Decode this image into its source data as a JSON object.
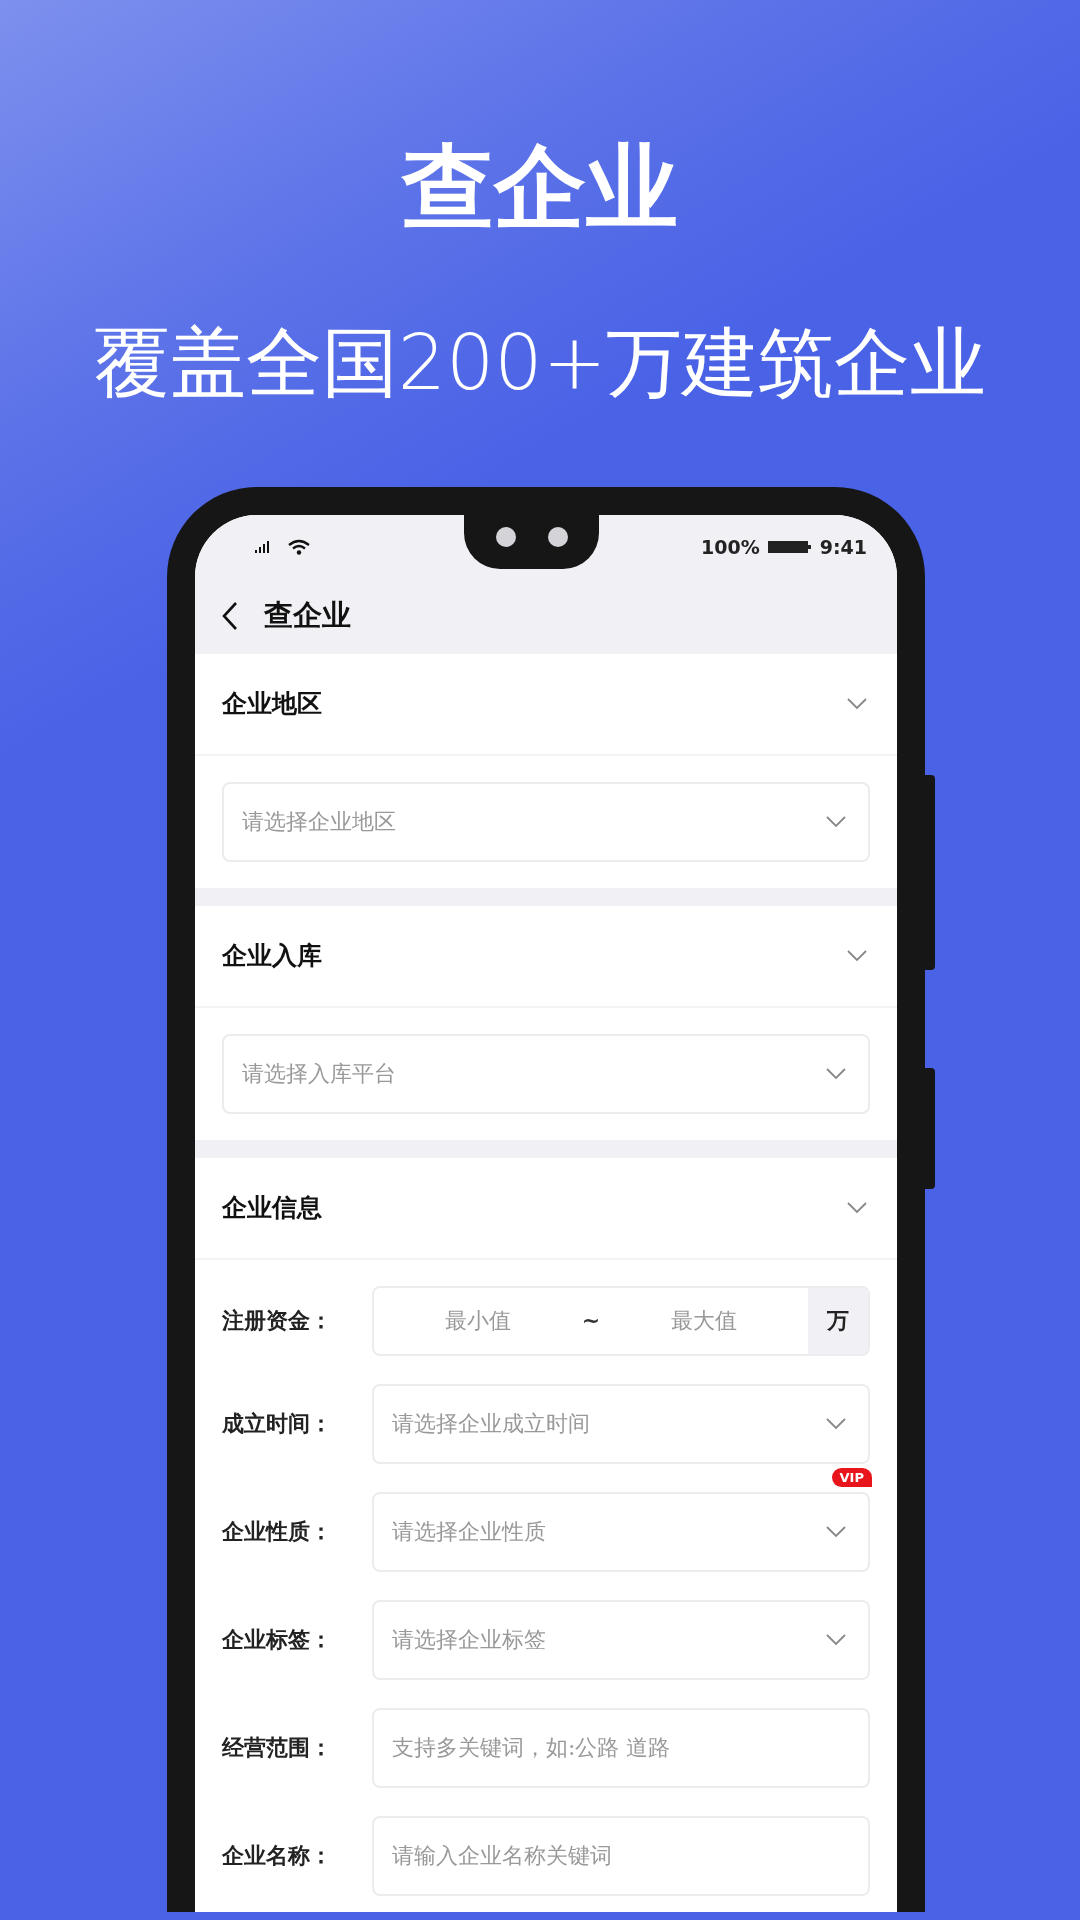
{
  "headline": "查企业",
  "subheadline": "覆盖全国200+万建筑企业",
  "status_bar": {
    "battery": "100%",
    "time": "9:41"
  },
  "nav": {
    "title": "查企业"
  },
  "sections": [
    {
      "title": "企业地区",
      "fields": [
        {
          "kind": "select",
          "placeholder": "请选择企业地区"
        }
      ]
    },
    {
      "title": "企业入库",
      "fields": [
        {
          "kind": "select",
          "placeholder": "请选择入库平台"
        }
      ]
    },
    {
      "title": "企业信息",
      "fields": [
        {
          "kind": "range",
          "label": "注册资金：",
          "min_placeholder": "最小值",
          "separator": "~",
          "max_placeholder": "最大值",
          "unit": "万"
        },
        {
          "kind": "select",
          "label": "成立时间：",
          "placeholder": "请选择企业成立时间"
        },
        {
          "kind": "select",
          "label": "企业性质：",
          "placeholder": "请选择企业性质",
          "badge": "VIP"
        },
        {
          "kind": "select",
          "label": "企业标签：",
          "placeholder": "请选择企业标签"
        },
        {
          "kind": "text",
          "label": "经营范围：",
          "placeholder": "支持多关键词，如:公路 道路"
        },
        {
          "kind": "text",
          "label": "企业名称：",
          "placeholder": "请输入企业名称关键词"
        }
      ]
    }
  ]
}
